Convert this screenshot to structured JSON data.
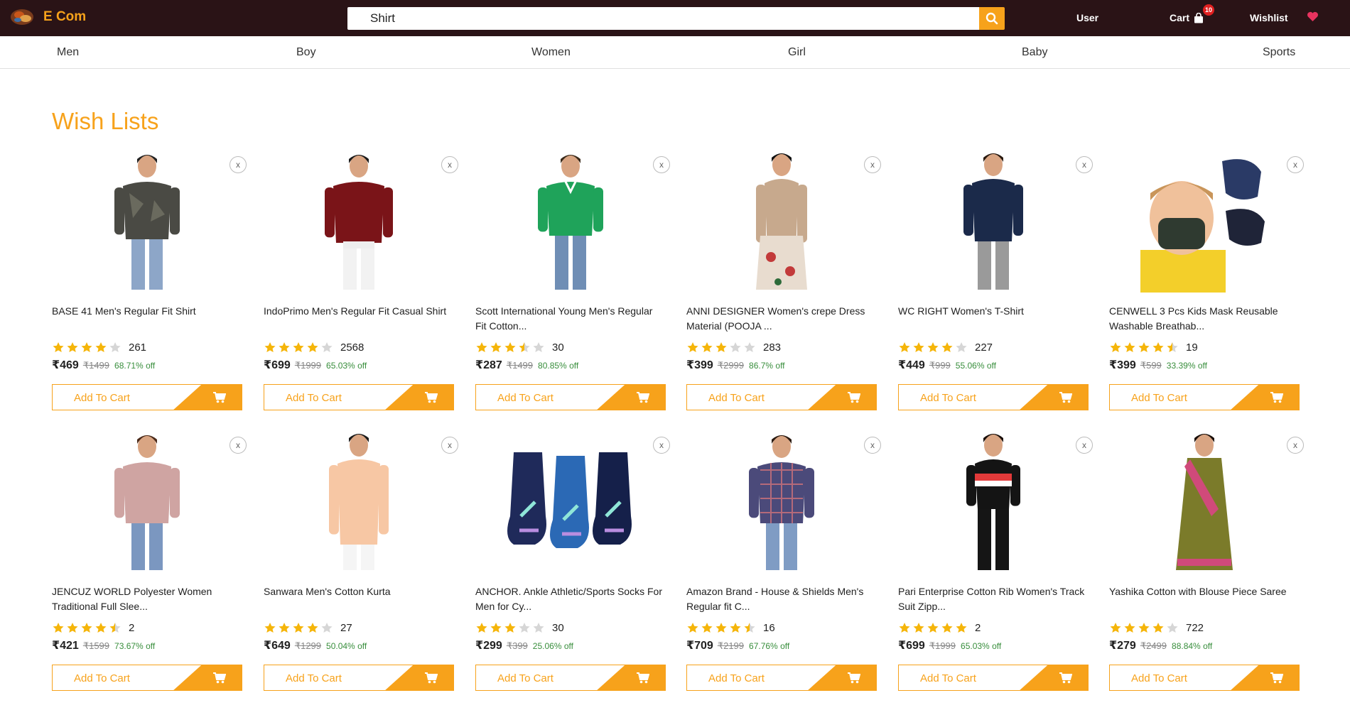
{
  "header": {
    "brand": "E Com",
    "search_value": "Shirt",
    "user_label": "User",
    "cart_label": "Cart",
    "cart_count": "10",
    "wishlist_label": "Wishlist"
  },
  "categories": [
    "Men",
    "Boy",
    "Women",
    "Girl",
    "Baby",
    "Sports"
  ],
  "page_title": "Wish Lists",
  "remove_label": "x",
  "add_to_cart_label": "Add To Cart",
  "colors": {
    "accent": "#f7a21b",
    "topbar": "#2a1316",
    "discount": "#388e3c",
    "star": "#f5b50a",
    "heart": "#e8335f"
  },
  "products": [
    {
      "title": "BASE 41 Men's Regular Fit Shirt",
      "rating": 4,
      "count": "261",
      "price": "₹469",
      "mrp": "₹1499",
      "off": "68.71% off",
      "img": "shirt-dark"
    },
    {
      "title": "IndoPrimo Men's Regular Fit Casual Shirt",
      "rating": 4,
      "count": "2568",
      "price": "₹699",
      "mrp": "₹1999",
      "off": "65.03% off",
      "img": "shirt-maroon"
    },
    {
      "title": "Scott International Young Men's Regular Fit Cotton...",
      "rating": 3.5,
      "count": "30",
      "price": "₹287",
      "mrp": "₹1499",
      "off": "80.85% off",
      "img": "polo-green"
    },
    {
      "title": "ANNI DESIGNER Women's crepe Dress Material (POOJA ...",
      "rating": 3,
      "count": "283",
      "price": "₹399",
      "mrp": "₹2999",
      "off": "86.7% off",
      "img": "dress-beige"
    },
    {
      "title": "WC RIGHT Women's T-Shirt",
      "rating": 4,
      "count": "227",
      "price": "₹449",
      "mrp": "₹999",
      "off": "55.06% off",
      "img": "top-navy"
    },
    {
      "title": "CENWELL 3 Pcs Kids Mask Reusable Washable Breathab...",
      "rating": 4.5,
      "count": "19",
      "price": "₹399",
      "mrp": "₹599",
      "off": "33.39% off",
      "img": "mask-kid"
    },
    {
      "title": "JENCUZ WORLD Polyester Women Traditional Full Slee...",
      "rating": 4.5,
      "count": "2",
      "price": "₹421",
      "mrp": "₹1599",
      "off": "73.67% off",
      "img": "blouse-pink"
    },
    {
      "title": "Sanwara Men's Cotton Kurta",
      "rating": 4,
      "count": "27",
      "price": "₹649",
      "mrp": "₹1299",
      "off": "50.04% off",
      "img": "kurta-peach"
    },
    {
      "title": "ANCHOR. Ankle Athletic/Sports Socks For Men for Cy...",
      "rating": 3,
      "count": "30",
      "price": "₹299",
      "mrp": "₹399",
      "off": "25.06% off",
      "img": "socks"
    },
    {
      "title": "Amazon Brand - House & Shields Men's Regular fit C...",
      "rating": 4.5,
      "count": "16",
      "price": "₹709",
      "mrp": "₹2199",
      "off": "67.76% off",
      "img": "shirt-check"
    },
    {
      "title": "Pari Enterprise Cotton Rib Women's Track Suit Zipp...",
      "rating": 5,
      "count": "2",
      "price": "₹699",
      "mrp": "₹1999",
      "off": "65.03% off",
      "img": "tracksuit"
    },
    {
      "title": "Yashika Cotton with Blouse Piece Saree",
      "rating": 4,
      "count": "722",
      "price": "₹279",
      "mrp": "₹2499",
      "off": "88.84% off",
      "img": "saree"
    }
  ]
}
